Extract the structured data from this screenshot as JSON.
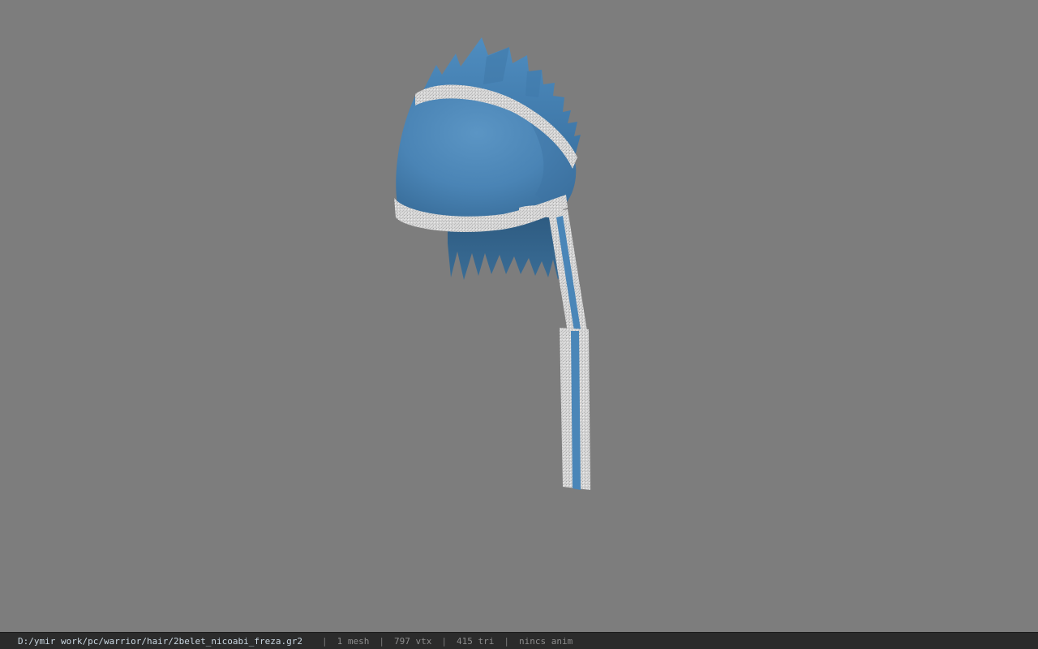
{
  "viewer": {
    "background_color": "#7d7d7d",
    "model": {
      "name": "hair-model",
      "primary_color": "#4a86b8",
      "trim_color": "#d8d8d8"
    }
  },
  "statusbar": {
    "file_path": "D:/ymir work/pc/warrior/hair/2belet_nicoabi_freza.gr2",
    "separator": "|",
    "mesh_count": "1 mesh",
    "vertex_count": "797 vtx",
    "triangle_count": "415 tri",
    "anim_status": "nincs anim"
  }
}
